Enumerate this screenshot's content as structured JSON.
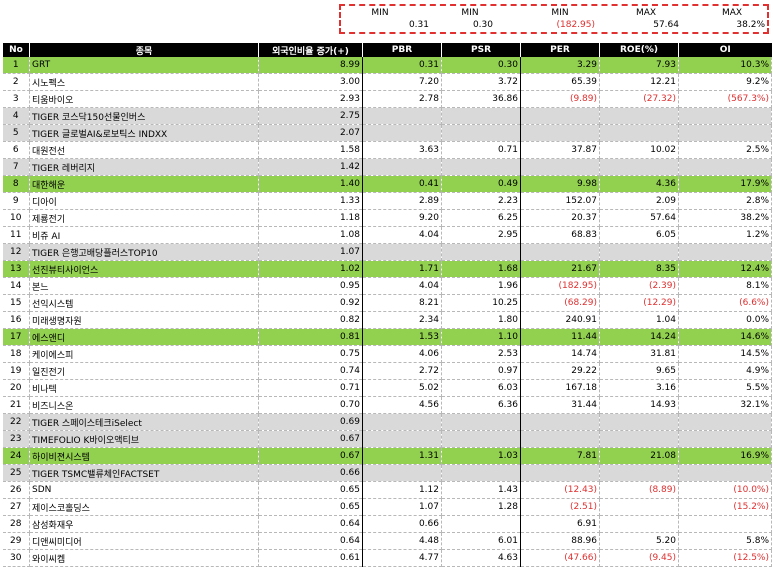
{
  "summary": {
    "labels": [
      "MIN",
      "MIN",
      "MIN",
      "MAX",
      "MAX"
    ],
    "values": [
      "0.31",
      "0.30",
      "(182.95)",
      "57.64",
      "38.2%"
    ],
    "negative": [
      false,
      false,
      true,
      false,
      false
    ]
  },
  "columns": [
    "No",
    "종목",
    "외국인비율 증가(+)",
    "PBR",
    "PSR",
    "PER",
    "ROE(%)",
    "OI"
  ],
  "rows": [
    {
      "no": "1",
      "name": "GRT",
      "ratio": "8.99",
      "pbr": "0.31",
      "psr": "0.30",
      "per": "3.29",
      "roe": "7.93",
      "oi": "10.3%",
      "style": "green"
    },
    {
      "no": "2",
      "name": "시노펙스",
      "ratio": "3.00",
      "pbr": "7.20",
      "psr": "3.72",
      "per": "65.39",
      "roe": "12.21",
      "oi": "9.2%",
      "style": ""
    },
    {
      "no": "3",
      "name": "티움바이오",
      "ratio": "2.93",
      "pbr": "2.78",
      "psr": "36.86",
      "per": "(9.89)",
      "roe": "(27.32)",
      "oi": "(567.3%)",
      "style": ""
    },
    {
      "no": "4",
      "name": "TIGER 코스닥150선물인버스",
      "ratio": "2.75",
      "pbr": "",
      "psr": "",
      "per": "",
      "roe": "",
      "oi": "",
      "style": "gray"
    },
    {
      "no": "5",
      "name": "TIGER 글로벌AI&로보틱스 INDXX",
      "ratio": "2.07",
      "pbr": "",
      "psr": "",
      "per": "",
      "roe": "",
      "oi": "",
      "style": "gray"
    },
    {
      "no": "6",
      "name": "대원전선",
      "ratio": "1.58",
      "pbr": "3.63",
      "psr": "0.71",
      "per": "37.87",
      "roe": "10.02",
      "oi": "2.5%",
      "style": ""
    },
    {
      "no": "7",
      "name": "TIGER 레버리지",
      "ratio": "1.42",
      "pbr": "",
      "psr": "",
      "per": "",
      "roe": "",
      "oi": "",
      "style": "gray"
    },
    {
      "no": "8",
      "name": "대한해운",
      "ratio": "1.40",
      "pbr": "0.41",
      "psr": "0.49",
      "per": "9.98",
      "roe": "4.36",
      "oi": "17.9%",
      "style": "green"
    },
    {
      "no": "9",
      "name": "디아이",
      "ratio": "1.33",
      "pbr": "2.89",
      "psr": "2.23",
      "per": "152.07",
      "roe": "2.09",
      "oi": "2.8%",
      "style": ""
    },
    {
      "no": "10",
      "name": "제룡전기",
      "ratio": "1.18",
      "pbr": "9.20",
      "psr": "6.25",
      "per": "20.37",
      "roe": "57.64",
      "oi": "38.2%",
      "style": ""
    },
    {
      "no": "11",
      "name": "비쥬 AI",
      "ratio": "1.08",
      "pbr": "4.04",
      "psr": "2.95",
      "per": "68.83",
      "roe": "6.05",
      "oi": "1.2%",
      "style": ""
    },
    {
      "no": "12",
      "name": "TIGER 은행고배당플러스TOP10",
      "ratio": "1.07",
      "pbr": "",
      "psr": "",
      "per": "",
      "roe": "",
      "oi": "",
      "style": "gray"
    },
    {
      "no": "13",
      "name": "선진뷰티사이언스",
      "ratio": "1.02",
      "pbr": "1.71",
      "psr": "1.68",
      "per": "21.67",
      "roe": "8.35",
      "oi": "12.4%",
      "style": "green"
    },
    {
      "no": "14",
      "name": "본느",
      "ratio": "0.95",
      "pbr": "4.04",
      "psr": "1.96",
      "per": "(182.95)",
      "roe": "(2.39)",
      "oi": "8.1%",
      "style": ""
    },
    {
      "no": "15",
      "name": "선익시스템",
      "ratio": "0.92",
      "pbr": "8.21",
      "psr": "10.25",
      "per": "(68.29)",
      "roe": "(12.29)",
      "oi": "(6.6%)",
      "style": ""
    },
    {
      "no": "16",
      "name": "미래생명자원",
      "ratio": "0.82",
      "pbr": "2.34",
      "psr": "1.80",
      "per": "240.91",
      "roe": "1.04",
      "oi": "0.0%",
      "style": ""
    },
    {
      "no": "17",
      "name": "에스앤디",
      "ratio": "0.81",
      "pbr": "1.53",
      "psr": "1.10",
      "per": "11.44",
      "roe": "14.24",
      "oi": "14.6%",
      "style": "green"
    },
    {
      "no": "18",
      "name": "케이에스피",
      "ratio": "0.75",
      "pbr": "4.06",
      "psr": "2.53",
      "per": "14.74",
      "roe": "31.81",
      "oi": "14.5%",
      "style": ""
    },
    {
      "no": "19",
      "name": "일진전기",
      "ratio": "0.74",
      "pbr": "2.72",
      "psr": "0.97",
      "per": "29.22",
      "roe": "9.65",
      "oi": "4.9%",
      "style": ""
    },
    {
      "no": "20",
      "name": "비나텍",
      "ratio": "0.71",
      "pbr": "5.02",
      "psr": "6.03",
      "per": "167.18",
      "roe": "3.16",
      "oi": "5.5%",
      "style": ""
    },
    {
      "no": "21",
      "name": "비즈니스온",
      "ratio": "0.70",
      "pbr": "4.56",
      "psr": "6.36",
      "per": "31.44",
      "roe": "14.93",
      "oi": "32.1%",
      "style": ""
    },
    {
      "no": "22",
      "name": "TIGER 스페이스테크iSelect",
      "ratio": "0.69",
      "pbr": "",
      "psr": "",
      "per": "",
      "roe": "",
      "oi": "",
      "style": "gray"
    },
    {
      "no": "23",
      "name": "TIMEFOLIO K바이오액티브",
      "ratio": "0.67",
      "pbr": "",
      "psr": "",
      "per": "",
      "roe": "",
      "oi": "",
      "style": "gray"
    },
    {
      "no": "24",
      "name": "하이비젼시스템",
      "ratio": "0.67",
      "pbr": "1.31",
      "psr": "1.03",
      "per": "7.81",
      "roe": "21.08",
      "oi": "16.9%",
      "style": "green"
    },
    {
      "no": "25",
      "name": "TIGER TSMC밸류체인FACTSET",
      "ratio": "0.66",
      "pbr": "",
      "psr": "",
      "per": "",
      "roe": "",
      "oi": "",
      "style": "gray"
    },
    {
      "no": "26",
      "name": "SDN",
      "ratio": "0.65",
      "pbr": "1.12",
      "psr": "1.43",
      "per": "(12.43)",
      "roe": "(8.89)",
      "oi": "(10.0%)",
      "style": ""
    },
    {
      "no": "27",
      "name": "제이스코홀딩스",
      "ratio": "0.65",
      "pbr": "1.07",
      "psr": "1.28",
      "per": "(2.51)",
      "roe": "",
      "oi": "(15.2%)",
      "style": ""
    },
    {
      "no": "28",
      "name": "삼성화재우",
      "ratio": "0.64",
      "pbr": "0.66",
      "psr": "",
      "per": "6.91",
      "roe": "",
      "oi": "",
      "style": ""
    },
    {
      "no": "29",
      "name": "디앤씨미디어",
      "ratio": "0.64",
      "pbr": "4.48",
      "psr": "6.01",
      "per": "88.96",
      "roe": "5.20",
      "oi": "5.8%",
      "style": ""
    },
    {
      "no": "30",
      "name": "와이씨켐",
      "ratio": "0.61",
      "pbr": "4.77",
      "psr": "4.63",
      "per": "(47.66)",
      "roe": "(9.45)",
      "oi": "(12.5%)",
      "style": ""
    }
  ]
}
